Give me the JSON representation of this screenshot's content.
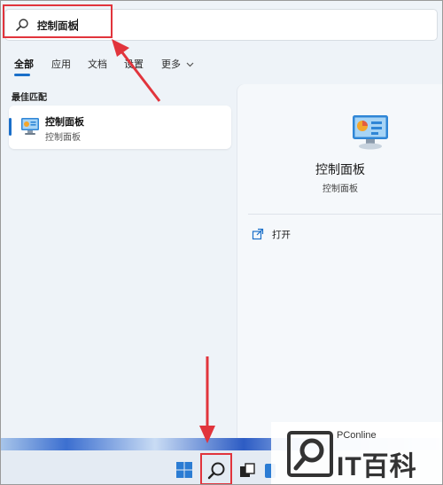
{
  "search": {
    "query": "控制面板"
  },
  "tabs": [
    {
      "label": "全部",
      "active": true
    },
    {
      "label": "应用",
      "active": false
    },
    {
      "label": "文档",
      "active": false
    },
    {
      "label": "设置",
      "active": false
    },
    {
      "label": "更多",
      "active": false,
      "has_dropdown": true
    }
  ],
  "best_match": {
    "section_title": "最佳匹配",
    "item": {
      "title": "控制面板",
      "subtitle": "控制面板",
      "icon": "control-panel-icon"
    }
  },
  "detail": {
    "title": "控制面板",
    "subtitle": "控制面板",
    "icon": "control-panel-icon",
    "actions": [
      {
        "label": "打开",
        "icon": "open-icon"
      }
    ]
  },
  "taskbar": {
    "items": [
      "start-icon",
      "search-icon",
      "task-view-icon",
      "widgets-icon"
    ]
  },
  "watermark": {
    "small": "PConline",
    "brand": "IT百科"
  },
  "colors": {
    "accent": "#1a6fc9",
    "highlight": "#e1343c",
    "arrow": "#e1343c"
  }
}
